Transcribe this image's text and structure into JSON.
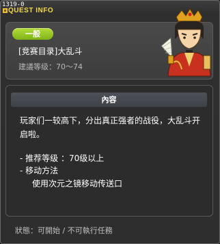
{
  "window": {
    "quest_id": "1319-0",
    "title": "QUEST INFO"
  },
  "header": {
    "level_badge": "一般",
    "quest_name": "[竞赛目录]大乱斗",
    "quest_level": "建議等级：70～74"
  },
  "body": {
    "section_title": "內容",
    "description": "玩家们一较高下，分出真正强者的战役，大乱斗开启啦。",
    "details": [
      "- 推荐等级 ：70级以上",
      "- 移动方法",
      "使用次元之镜移动传送口"
    ]
  },
  "status": "狀態：可開始 / 不可執行任務",
  "colors": {
    "title": "#f4d84a",
    "badge": "#8fc21e",
    "panel": "#3d3d3d"
  }
}
